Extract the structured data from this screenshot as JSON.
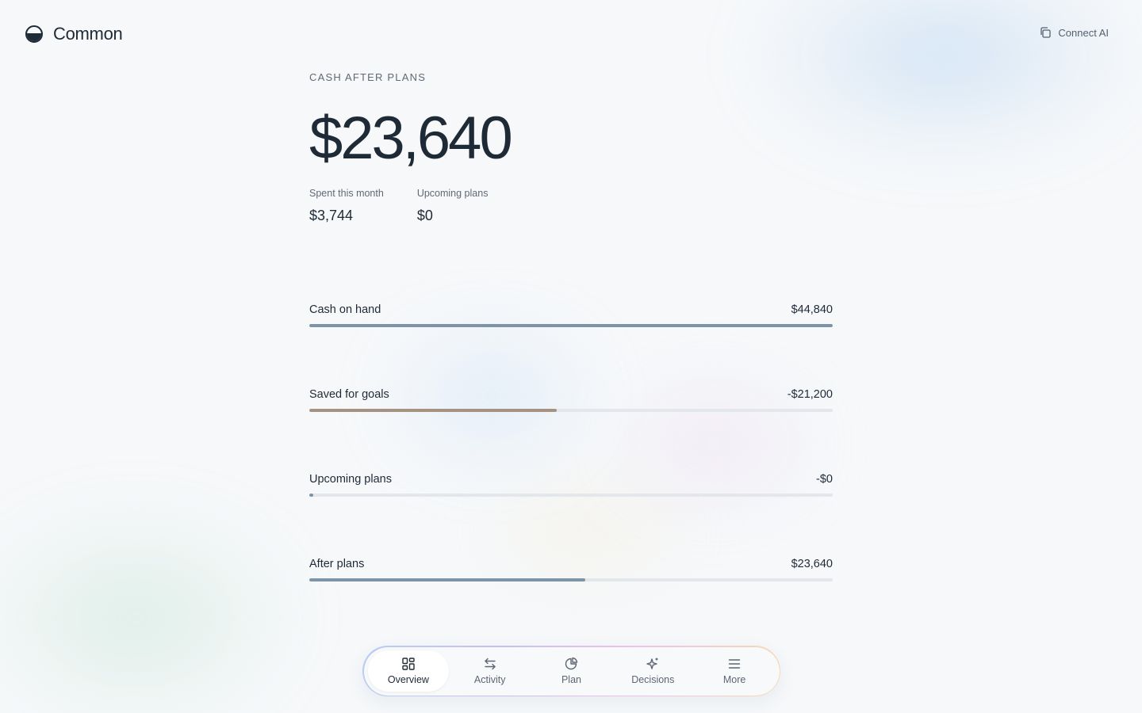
{
  "app": {
    "name": "Common",
    "connect_label": "Connect AI"
  },
  "summary": {
    "title": "CASH AFTER PLANS",
    "amount": "$23,640",
    "stats": [
      {
        "label": "Spent this month",
        "value": "$3,744"
      },
      {
        "label": "Upcoming plans",
        "value": "$0"
      }
    ]
  },
  "breakdown": [
    {
      "label": "Cash on hand",
      "amount": "$44,840",
      "fill": 1.0,
      "color": "#7d93a8"
    },
    {
      "label": "Saved for goals",
      "amount": "-$21,200",
      "fill": 0.473,
      "color": "#a59283"
    },
    {
      "label": "Upcoming plans",
      "amount": "-$0",
      "fill": 0.008,
      "color": "#7d93a8"
    },
    {
      "label": "After plans",
      "amount": "$23,640",
      "fill": 0.527,
      "color": "#7d93a8"
    }
  ],
  "nav": {
    "active": "Overview",
    "tabs": [
      {
        "label": "Overview",
        "icon": "grid-icon"
      },
      {
        "label": "Activity",
        "icon": "arrows-swap-icon"
      },
      {
        "label": "Plan",
        "icon": "pie-icon"
      },
      {
        "label": "Decisions",
        "icon": "sparkle-icon"
      },
      {
        "label": "More",
        "icon": "menu-icon"
      }
    ]
  }
}
